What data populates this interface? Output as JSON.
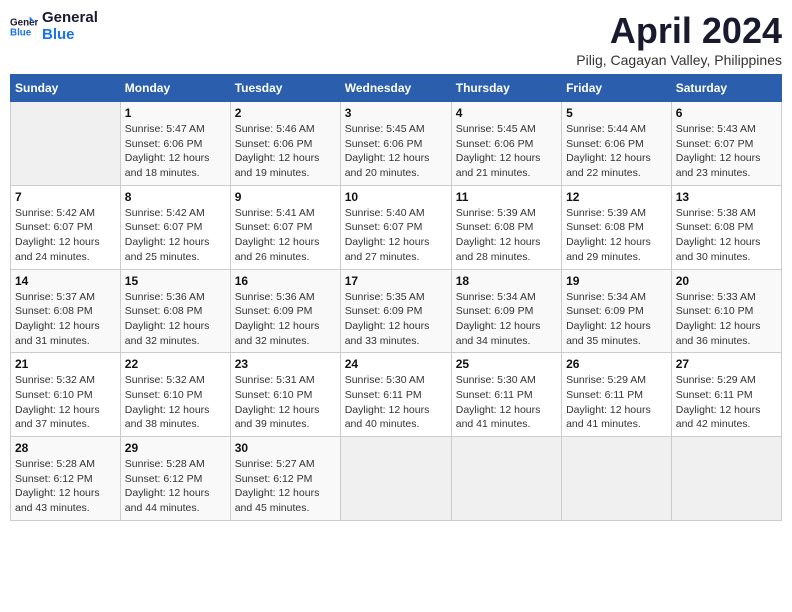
{
  "header": {
    "logo_line1": "General",
    "logo_line2": "Blue",
    "title": "April 2024",
    "subtitle": "Pilig, Cagayan Valley, Philippines"
  },
  "weekdays": [
    "Sunday",
    "Monday",
    "Tuesday",
    "Wednesday",
    "Thursday",
    "Friday",
    "Saturday"
  ],
  "weeks": [
    [
      {
        "day": "",
        "info": ""
      },
      {
        "day": "1",
        "info": "Sunrise: 5:47 AM\nSunset: 6:06 PM\nDaylight: 12 hours\nand 18 minutes."
      },
      {
        "day": "2",
        "info": "Sunrise: 5:46 AM\nSunset: 6:06 PM\nDaylight: 12 hours\nand 19 minutes."
      },
      {
        "day": "3",
        "info": "Sunrise: 5:45 AM\nSunset: 6:06 PM\nDaylight: 12 hours\nand 20 minutes."
      },
      {
        "day": "4",
        "info": "Sunrise: 5:45 AM\nSunset: 6:06 PM\nDaylight: 12 hours\nand 21 minutes."
      },
      {
        "day": "5",
        "info": "Sunrise: 5:44 AM\nSunset: 6:06 PM\nDaylight: 12 hours\nand 22 minutes."
      },
      {
        "day": "6",
        "info": "Sunrise: 5:43 AM\nSunset: 6:07 PM\nDaylight: 12 hours\nand 23 minutes."
      }
    ],
    [
      {
        "day": "7",
        "info": "Sunrise: 5:42 AM\nSunset: 6:07 PM\nDaylight: 12 hours\nand 24 minutes."
      },
      {
        "day": "8",
        "info": "Sunrise: 5:42 AM\nSunset: 6:07 PM\nDaylight: 12 hours\nand 25 minutes."
      },
      {
        "day": "9",
        "info": "Sunrise: 5:41 AM\nSunset: 6:07 PM\nDaylight: 12 hours\nand 26 minutes."
      },
      {
        "day": "10",
        "info": "Sunrise: 5:40 AM\nSunset: 6:07 PM\nDaylight: 12 hours\nand 27 minutes."
      },
      {
        "day": "11",
        "info": "Sunrise: 5:39 AM\nSunset: 6:08 PM\nDaylight: 12 hours\nand 28 minutes."
      },
      {
        "day": "12",
        "info": "Sunrise: 5:39 AM\nSunset: 6:08 PM\nDaylight: 12 hours\nand 29 minutes."
      },
      {
        "day": "13",
        "info": "Sunrise: 5:38 AM\nSunset: 6:08 PM\nDaylight: 12 hours\nand 30 minutes."
      }
    ],
    [
      {
        "day": "14",
        "info": "Sunrise: 5:37 AM\nSunset: 6:08 PM\nDaylight: 12 hours\nand 31 minutes."
      },
      {
        "day": "15",
        "info": "Sunrise: 5:36 AM\nSunset: 6:08 PM\nDaylight: 12 hours\nand 32 minutes."
      },
      {
        "day": "16",
        "info": "Sunrise: 5:36 AM\nSunset: 6:09 PM\nDaylight: 12 hours\nand 32 minutes."
      },
      {
        "day": "17",
        "info": "Sunrise: 5:35 AM\nSunset: 6:09 PM\nDaylight: 12 hours\nand 33 minutes."
      },
      {
        "day": "18",
        "info": "Sunrise: 5:34 AM\nSunset: 6:09 PM\nDaylight: 12 hours\nand 34 minutes."
      },
      {
        "day": "19",
        "info": "Sunrise: 5:34 AM\nSunset: 6:09 PM\nDaylight: 12 hours\nand 35 minutes."
      },
      {
        "day": "20",
        "info": "Sunrise: 5:33 AM\nSunset: 6:10 PM\nDaylight: 12 hours\nand 36 minutes."
      }
    ],
    [
      {
        "day": "21",
        "info": "Sunrise: 5:32 AM\nSunset: 6:10 PM\nDaylight: 12 hours\nand 37 minutes."
      },
      {
        "day": "22",
        "info": "Sunrise: 5:32 AM\nSunset: 6:10 PM\nDaylight: 12 hours\nand 38 minutes."
      },
      {
        "day": "23",
        "info": "Sunrise: 5:31 AM\nSunset: 6:10 PM\nDaylight: 12 hours\nand 39 minutes."
      },
      {
        "day": "24",
        "info": "Sunrise: 5:30 AM\nSunset: 6:11 PM\nDaylight: 12 hours\nand 40 minutes."
      },
      {
        "day": "25",
        "info": "Sunrise: 5:30 AM\nSunset: 6:11 PM\nDaylight: 12 hours\nand 41 minutes."
      },
      {
        "day": "26",
        "info": "Sunrise: 5:29 AM\nSunset: 6:11 PM\nDaylight: 12 hours\nand 41 minutes."
      },
      {
        "day": "27",
        "info": "Sunrise: 5:29 AM\nSunset: 6:11 PM\nDaylight: 12 hours\nand 42 minutes."
      }
    ],
    [
      {
        "day": "28",
        "info": "Sunrise: 5:28 AM\nSunset: 6:12 PM\nDaylight: 12 hours\nand 43 minutes."
      },
      {
        "day": "29",
        "info": "Sunrise: 5:28 AM\nSunset: 6:12 PM\nDaylight: 12 hours\nand 44 minutes."
      },
      {
        "day": "30",
        "info": "Sunrise: 5:27 AM\nSunset: 6:12 PM\nDaylight: 12 hours\nand 45 minutes."
      },
      {
        "day": "",
        "info": ""
      },
      {
        "day": "",
        "info": ""
      },
      {
        "day": "",
        "info": ""
      },
      {
        "day": "",
        "info": ""
      }
    ]
  ]
}
